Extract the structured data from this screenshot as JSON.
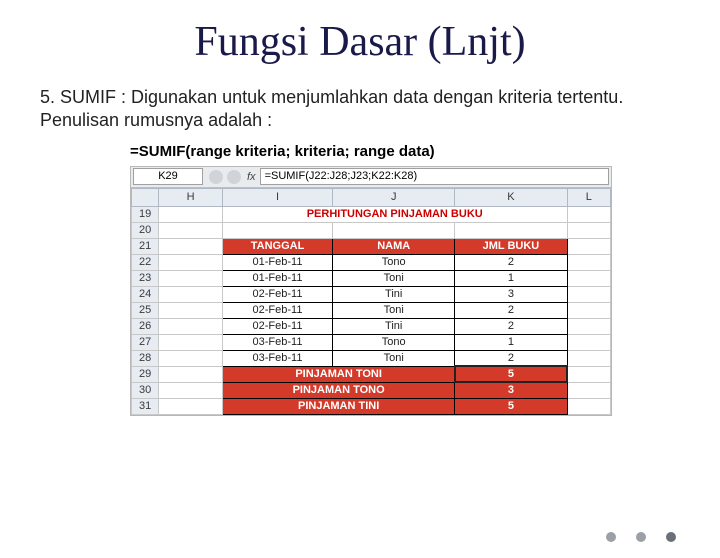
{
  "title": "Fungsi Dasar (Lnjt)",
  "body": "5. SUMIF : Digunakan untuk menjumlahkan data dengan kriteria tertentu. Penulisan rumusnya adalah :",
  "formula_syntax": "=SUMIF(range kriteria; kriteria; range data)",
  "excel": {
    "name_box": "K29",
    "formula_bar": "=SUMIF(J22:J28;J23;K22:K28)",
    "col_headers": [
      "H",
      "I",
      "J",
      "K",
      "L"
    ],
    "row_start": 19,
    "title_row": {
      "idx": 19,
      "text": "PERHITUNGAN PINJAMAN BUKU"
    },
    "header_row": {
      "idx": 21,
      "cells": [
        "TANGGAL",
        "NAMA",
        "JML BUKU"
      ]
    },
    "data_rows": [
      {
        "idx": 22,
        "tanggal": "01-Feb-11",
        "nama": "Tono",
        "jml": "2"
      },
      {
        "idx": 23,
        "tanggal": "01-Feb-11",
        "nama": "Toni",
        "jml": "1"
      },
      {
        "idx": 24,
        "tanggal": "02-Feb-11",
        "nama": "Tini",
        "jml": "3"
      },
      {
        "idx": 25,
        "tanggal": "02-Feb-11",
        "nama": "Toni",
        "jml": "2"
      },
      {
        "idx": 26,
        "tanggal": "02-Feb-11",
        "nama": "Tini",
        "jml": "2"
      },
      {
        "idx": 27,
        "tanggal": "03-Feb-11",
        "nama": "Tono",
        "jml": "1"
      },
      {
        "idx": 28,
        "tanggal": "03-Feb-11",
        "nama": "Toni",
        "jml": "2"
      }
    ],
    "summary_rows": [
      {
        "idx": 29,
        "label": "PINJAMAN TONI",
        "val": "5",
        "selected": true
      },
      {
        "idx": 30,
        "label": "PINJAMAN TONO",
        "val": "3"
      },
      {
        "idx": 31,
        "label": "PINJAMAN TINI",
        "val": "5"
      }
    ]
  }
}
